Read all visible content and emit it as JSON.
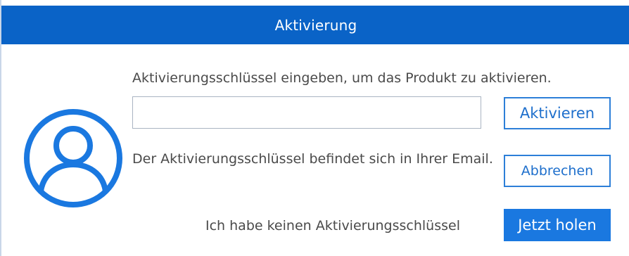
{
  "window": {
    "title": "Aktivierung"
  },
  "form": {
    "instruction": "Aktivierungsschlüssel eingeben, um das Produkt zu aktivieren.",
    "key_value": "",
    "info": "Der Aktivierungsschlüssel befindet sich in Ihrer Email.",
    "no_key": "Ich habe keinen Aktivierungsschlüssel"
  },
  "buttons": {
    "activate": "Aktivieren",
    "cancel": "Abbrechen",
    "get_now": "Jetzt holen"
  },
  "icons": {
    "avatar": "user-avatar-icon"
  },
  "colors": {
    "accent": "#0a63c7",
    "button_primary": "#1a78e0",
    "button_outline": "#2d7fd8",
    "text": "#4a4a4a"
  }
}
